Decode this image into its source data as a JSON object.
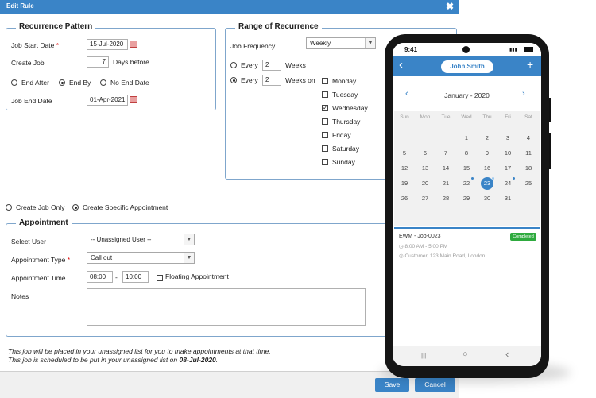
{
  "window": {
    "title": "Edit Rule",
    "close_glyph": "✖"
  },
  "recurrence_pattern": {
    "legend": "Recurrence Pattern",
    "job_start_date_label": "Job Start Date",
    "required_mark": "*",
    "job_start_date": "15-Jul-2020",
    "create_job_label": "Create Job",
    "create_job_days": "7",
    "days_before_label": "Days before",
    "end_after_label": "End After",
    "end_by_label": "End By",
    "no_end_date_label": "No End Date",
    "selected_end": "End By",
    "job_end_date_label": "Job End Date",
    "job_end_date": "01-Apr-2021"
  },
  "range_of_recurrence": {
    "legend": "Range of Recurrence",
    "job_frequency_label": "Job Frequency",
    "job_frequency": "Weekly",
    "every_label": "Every",
    "every_weeks_1": "2",
    "weeks_label": "Weeks",
    "every_weeks_2": "2",
    "weeks_on_label": "Weeks on",
    "selected_option": "weeks_on",
    "days": [
      {
        "name": "Monday",
        "checked": false
      },
      {
        "name": "Tuesday",
        "checked": false
      },
      {
        "name": "Wednesday",
        "checked": true
      },
      {
        "name": "Thursday",
        "checked": false
      },
      {
        "name": "Friday",
        "checked": false
      },
      {
        "name": "Saturday",
        "checked": false
      },
      {
        "name": "Sunday",
        "checked": false
      }
    ],
    "check_glyph": "✓"
  },
  "job_mode": {
    "create_job_only_label": "Create Job Only",
    "create_specific_label": "Create Specific Appointment",
    "selected": "specific"
  },
  "appointment": {
    "legend": "Appointment",
    "select_user_label": "Select User",
    "select_user_value": "-- Unassigned User --",
    "appointment_type_label": "Appointment Type",
    "required_mark": "*",
    "appointment_type_value": "Call out",
    "appointment_time_label": "Appointment Time",
    "time_from": "08:00",
    "time_sep": "-",
    "time_to": "10:00",
    "floating_label": "Floating Appointment",
    "notes_label": "Notes"
  },
  "info": {
    "line1": "This job will be placed in your unassigned list for you to make appointments at that time.",
    "line2_prefix": "This job is scheduled to be put in your unassigned list on ",
    "line2_date": "08-Jul-2020",
    "line2_suffix": "."
  },
  "footer": {
    "save_label": "Save",
    "cancel_label": "Cancel"
  },
  "phone": {
    "time": "9:41",
    "header_user": "John Smith",
    "back_glyph": "‹",
    "add_glyph": "+",
    "month_label": "January - 2020",
    "prev_glyph": "‹",
    "next_glyph": "›",
    "weekdays": [
      "Sun",
      "Mon",
      "Tue",
      "Wed",
      "Thu",
      "Fri",
      "Sat"
    ],
    "weeks": [
      [
        "",
        "",
        "",
        "1",
        "2",
        "3",
        "4"
      ],
      [
        "5",
        "6",
        "7",
        "8",
        "9",
        "10",
        "11"
      ],
      [
        "12",
        "13",
        "14",
        "15",
        "16",
        "17",
        "18"
      ],
      [
        "19",
        "20",
        "21",
        "22",
        "23",
        "24",
        "25"
      ],
      [
        "26",
        "27",
        "28",
        "29",
        "30",
        "31",
        ""
      ]
    ],
    "selected_day": "23",
    "dotted_days": [
      "22",
      "23",
      "24"
    ],
    "job": {
      "title": "EWM - Job-0023",
      "status": "Completed",
      "time": "8:00 AM - 5:00 PM",
      "address": "Customer, 123 Main Road, London"
    },
    "nav": {
      "recent_glyph": "|||",
      "home_glyph": "○",
      "back_glyph": "‹"
    }
  },
  "colors": {
    "accent": "#3a84c7",
    "badge_green": "#2eaa3e",
    "required_red": "#dd0000"
  }
}
